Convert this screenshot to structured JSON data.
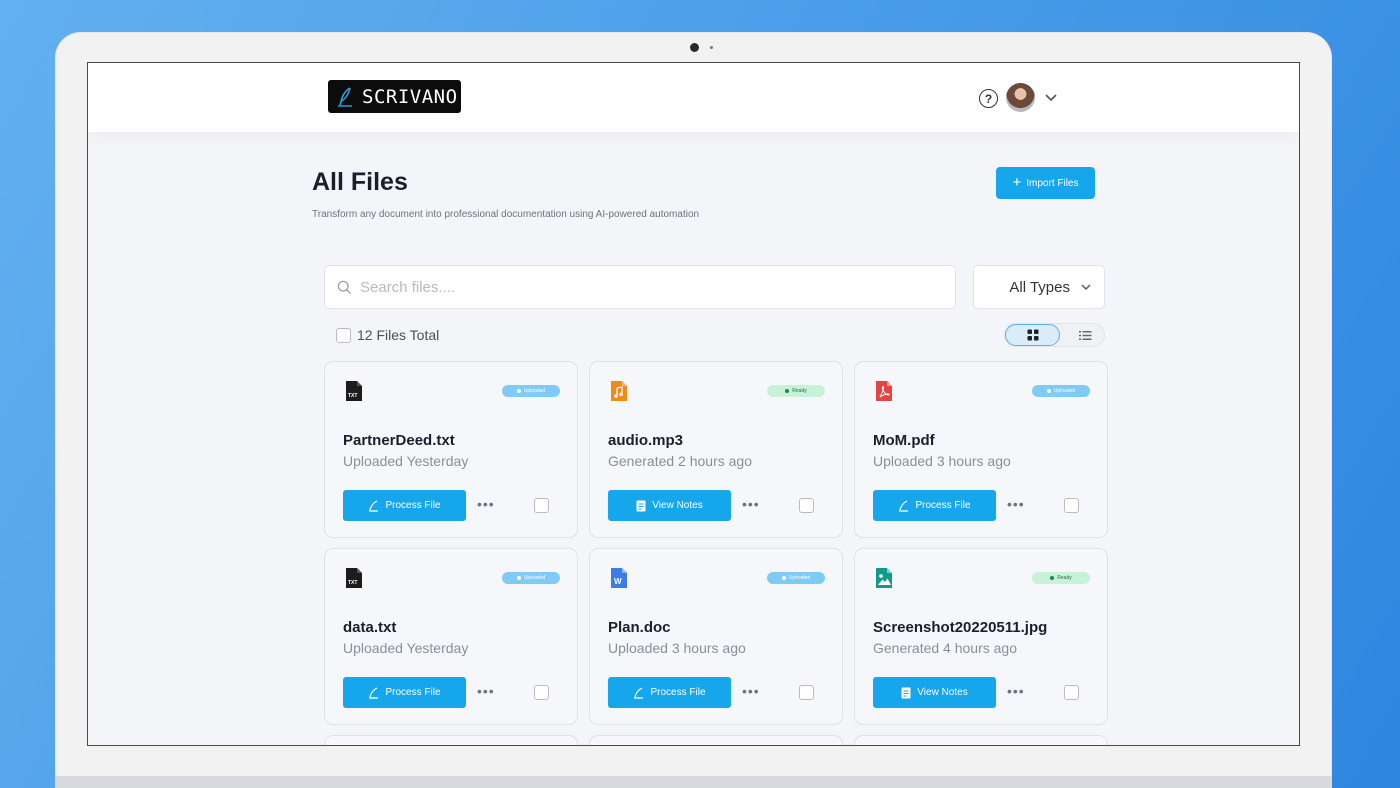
{
  "app": {
    "logo_text": "SCRIVANO"
  },
  "header": {
    "help_label": "?"
  },
  "page": {
    "title": "All Files",
    "subtitle": "Transform any document into professional documentation using AI-powered automation",
    "import_label": "Import Files"
  },
  "search": {
    "placeholder": "Search files...."
  },
  "filter": {
    "selected": "All Types"
  },
  "summary": {
    "total": "12 Files Total"
  },
  "view": {
    "mode": "grid"
  },
  "files": [
    {
      "name": "PartnerDeed.txt",
      "meta": "Uploaded Yesterday",
      "status": "Uploaded",
      "action": "Process File",
      "icon": "txt-file-icon"
    },
    {
      "name": "audio.mp3",
      "meta": "Generated 2 hours ago",
      "status": "Ready",
      "action": "View Notes",
      "icon": "audio-file-icon"
    },
    {
      "name": "MoM.pdf",
      "meta": "Uploaded 3 hours ago",
      "status": "Uploaded",
      "action": "Process File",
      "icon": "pdf-file-icon"
    },
    {
      "name": "data.txt",
      "meta": "Uploaded Yesterday",
      "status": "Uploaded",
      "action": "Process File",
      "icon": "txt-file-icon"
    },
    {
      "name": "Plan.doc",
      "meta": "Uploaded 3 hours ago",
      "status": "Uploaded",
      "action": "Process File",
      "icon": "doc-file-icon"
    },
    {
      "name": "Screenshot20220511.jpg",
      "meta": "Generated 4 hours ago",
      "status": "Ready",
      "action": "View Notes",
      "icon": "image-file-icon"
    }
  ],
  "colors": {
    "accent": "#16a6ec",
    "uploaded_badge": "#7fcbf6",
    "ready_badge": "#c9f1d7",
    "background": "#f4f5f8"
  }
}
